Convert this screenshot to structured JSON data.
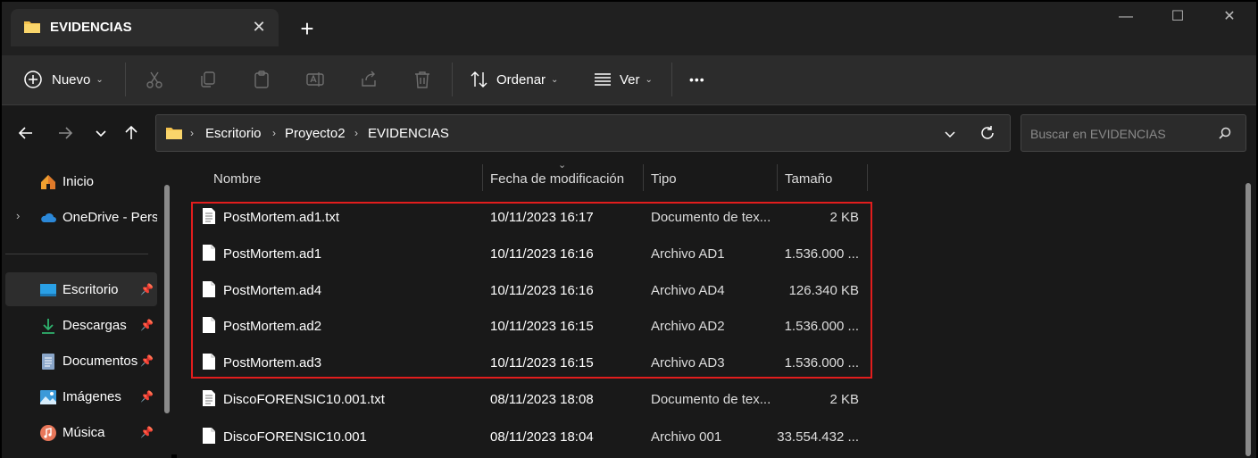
{
  "window": {
    "tab_title": "EVIDENCIAS",
    "new_tab": "+",
    "close_tab": "✕",
    "minimize": "—",
    "maximize": "☐",
    "close": "✕"
  },
  "toolbar": {
    "new_label": "Nuevo",
    "sort_label": "Ordenar",
    "view_label": "Ver",
    "more_label": "•••"
  },
  "address": {
    "crumbs": [
      "Escritorio",
      "Proyecto2",
      "EVIDENCIAS"
    ],
    "search_placeholder": "Buscar en EVIDENCIAS"
  },
  "sidebar": {
    "items": [
      {
        "label": "Inicio",
        "icon": "home-icon"
      },
      {
        "label": "OneDrive - Personal",
        "icon": "cloud-icon"
      },
      {
        "label": "Escritorio",
        "icon": "desktop-icon",
        "pinned": true
      },
      {
        "label": "Descargas",
        "icon": "download-icon",
        "pinned": true
      },
      {
        "label": "Documentos",
        "icon": "documents-icon",
        "pinned": true
      },
      {
        "label": "Imágenes",
        "icon": "pictures-icon",
        "pinned": true
      },
      {
        "label": "Música",
        "icon": "music-icon",
        "pinned": true
      }
    ]
  },
  "table": {
    "headers": {
      "name": "Nombre",
      "date": "Fecha de modificación",
      "type": "Tipo",
      "size": "Tamaño"
    },
    "rows": [
      {
        "name": "PostMortem.ad1.txt",
        "date": "10/11/2023 16:17",
        "type": "Documento de tex...",
        "size": "2 KB",
        "icon": "text-file-icon"
      },
      {
        "name": "PostMortem.ad1",
        "date": "10/11/2023 16:16",
        "type": "Archivo AD1",
        "size": "1.536.000 ...",
        "icon": "file-icon"
      },
      {
        "name": "PostMortem.ad4",
        "date": "10/11/2023 16:16",
        "type": "Archivo AD4",
        "size": "126.340 KB",
        "icon": "file-icon"
      },
      {
        "name": "PostMortem.ad2",
        "date": "10/11/2023 16:15",
        "type": "Archivo AD2",
        "size": "1.536.000 ...",
        "icon": "file-icon"
      },
      {
        "name": "PostMortem.ad3",
        "date": "10/11/2023 16:15",
        "type": "Archivo AD3",
        "size": "1.536.000 ...",
        "icon": "file-icon"
      },
      {
        "name": "DiscoFORENSIC10.001.txt",
        "date": "08/11/2023 18:08",
        "type": "Documento de tex...",
        "size": "2 KB",
        "icon": "text-file-icon"
      },
      {
        "name": "DiscoFORENSIC10.001",
        "date": "08/11/2023 18:04",
        "type": "Archivo 001",
        "size": "33.554.432 ...",
        "icon": "file-icon"
      }
    ]
  },
  "colors": {
    "background": "#191919",
    "toolbar": "#2c2c2c",
    "highlight": "#e21d1d",
    "folder": "#f4c24e"
  }
}
